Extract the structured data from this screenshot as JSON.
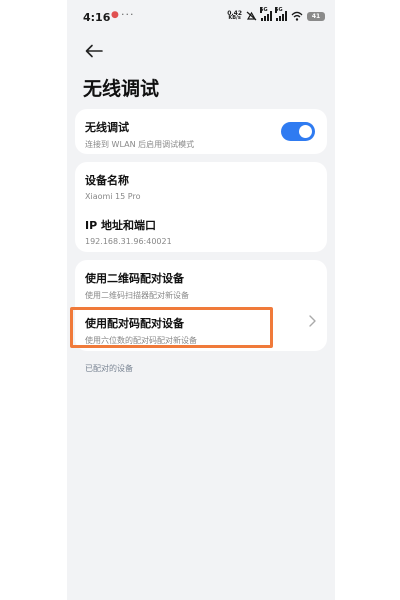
{
  "status_bar": {
    "time": "4:16",
    "notification_dot": "●",
    "more": "···",
    "net_speed_value": "0.42",
    "net_speed_unit": "KB/s",
    "sim1_label": "5G",
    "sim2_label": "5G",
    "battery": "41"
  },
  "page": {
    "title": "无线调试"
  },
  "debug_card": {
    "title": "无线调试",
    "subtitle": "连接到 WLAN 后启用调试模式",
    "toggle_on": true,
    "accent_color": "#2f7bf1"
  },
  "device_card": {
    "name_title": "设备名称",
    "name_value": "Xiaomi 15 Pro",
    "ip_title": "IP 地址和端口",
    "ip_value": "192.168.31.96:40021"
  },
  "pair_card": {
    "qr_title": "使用二维码配对设备",
    "qr_subtitle": "使用二维码扫描器配对新设备",
    "code_title": "使用配对码配对设备",
    "code_subtitle": "使用六位数的配对码配对新设备"
  },
  "paired_devices": {
    "label": "已配对的设备"
  },
  "highlight_color": "#f07a3a"
}
